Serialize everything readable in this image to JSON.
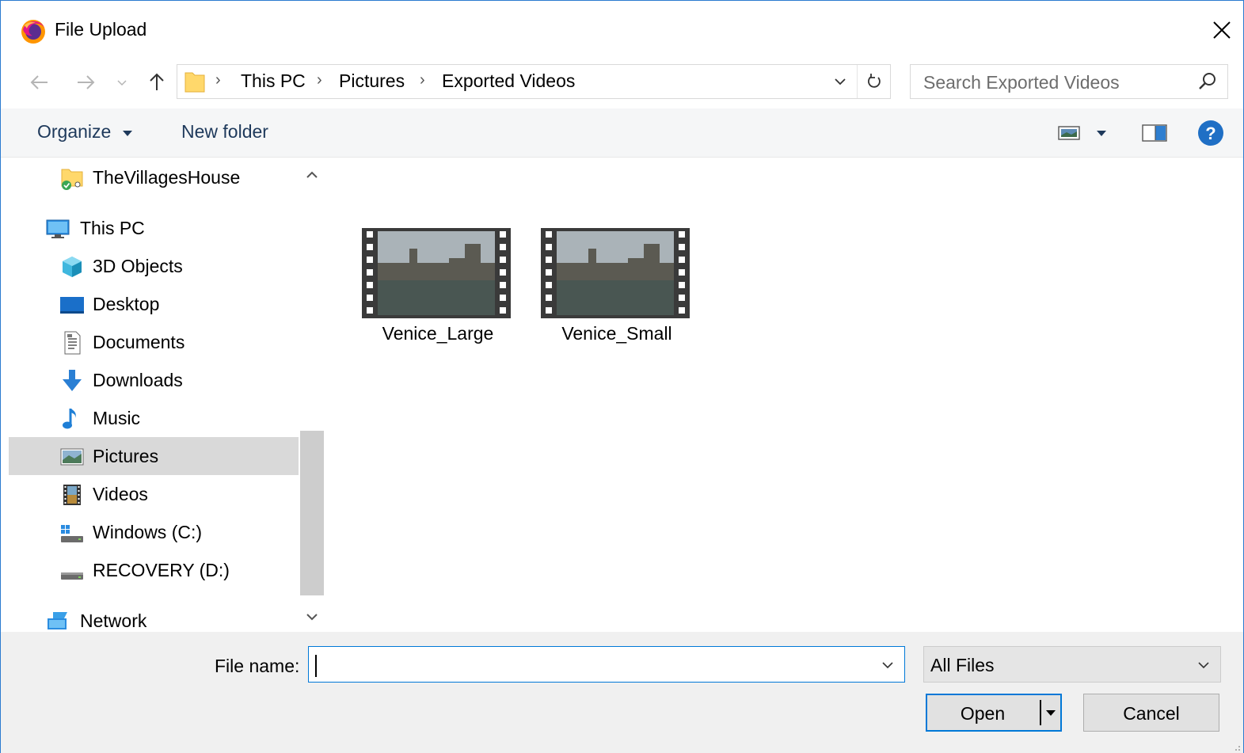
{
  "window": {
    "title": "File Upload"
  },
  "address": {
    "crumbs": [
      "This PC",
      "Pictures",
      "Exported Videos"
    ]
  },
  "search": {
    "placeholder": "Search Exported Videos"
  },
  "toolbar": {
    "organize_label": "Organize",
    "new_folder_label": "New folder"
  },
  "nav_pane": {
    "items": [
      {
        "label": "TheVillagesHouse",
        "icon": "network-folder-icon"
      },
      {
        "label": "This PC",
        "icon": "computer-icon"
      },
      {
        "label": "3D Objects",
        "icon": "3d-objects-icon"
      },
      {
        "label": "Desktop",
        "icon": "desktop-icon"
      },
      {
        "label": "Documents",
        "icon": "documents-icon"
      },
      {
        "label": "Downloads",
        "icon": "downloads-icon"
      },
      {
        "label": "Music",
        "icon": "music-icon"
      },
      {
        "label": "Pictures",
        "icon": "pictures-icon",
        "selected": true
      },
      {
        "label": "Videos",
        "icon": "videos-icon"
      },
      {
        "label": "Windows (C:)",
        "icon": "windows-drive-icon"
      },
      {
        "label": "RECOVERY (D:)",
        "icon": "drive-icon"
      },
      {
        "label": "Network",
        "icon": "network-icon"
      }
    ]
  },
  "files": [
    {
      "name": "Venice_Large",
      "icon": "video-thumbnail-icon"
    },
    {
      "name": "Venice_Small",
      "icon": "video-thumbnail-icon"
    }
  ],
  "bottom": {
    "file_name_label": "File name:",
    "file_name_value": "",
    "filter_value": "All Files",
    "open_label": "Open",
    "cancel_label": "Cancel"
  },
  "colors": {
    "accent": "#0078d7",
    "selected_bg": "#d9d9d9",
    "toolbar_text": "#1e395b"
  }
}
